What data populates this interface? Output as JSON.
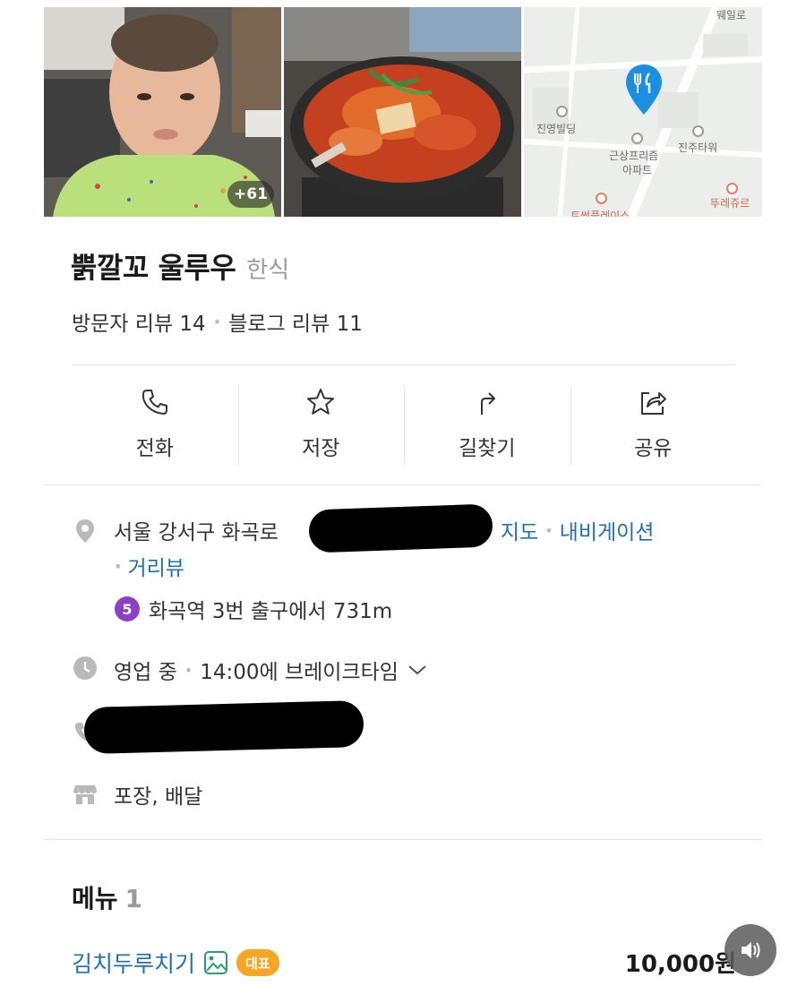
{
  "photos": {
    "more_count": "+61"
  },
  "map": {
    "labels": {
      "road": "웨일로",
      "building1": "진영빌딩",
      "building2": "진주타워",
      "apartment_line1": "근상프리즘",
      "apartment_line2": "아파트",
      "shop": "뚜레쥬르",
      "bottom": "트썬플레이스"
    }
  },
  "place": {
    "name": "뿕깔꼬 울루우",
    "category": "한식",
    "visitor_reviews": "방문자 리뷰 14",
    "blog_reviews": "블로그 리뷰 11"
  },
  "actions": [
    {
      "label": "전화",
      "icon": "phone-icon"
    },
    {
      "label": "저장",
      "icon": "star-icon"
    },
    {
      "label": "길찾기",
      "icon": "directions-icon"
    },
    {
      "label": "공유",
      "icon": "share-icon"
    }
  ],
  "info": {
    "address_prefix": "서울 강서구 화곡로",
    "map_link": "지도",
    "navigation_link": "내비게이션",
    "street_view_link": "거리뷰",
    "subway_line": "5",
    "subway_text": "화곡역 3번 출구에서 731m",
    "hours_status": "영업 중",
    "hours_detail": "14:00에 브레이크타임",
    "services": "포장, 배달"
  },
  "menu": {
    "title": "메뉴",
    "count": "1",
    "items": [
      {
        "name": "김치두루치기",
        "badge": "대표",
        "price": "10,000원"
      }
    ]
  },
  "colors": {
    "link": "#1f6fb8",
    "badge": "#f6a623",
    "subway_line5": "#8b3fc8"
  }
}
